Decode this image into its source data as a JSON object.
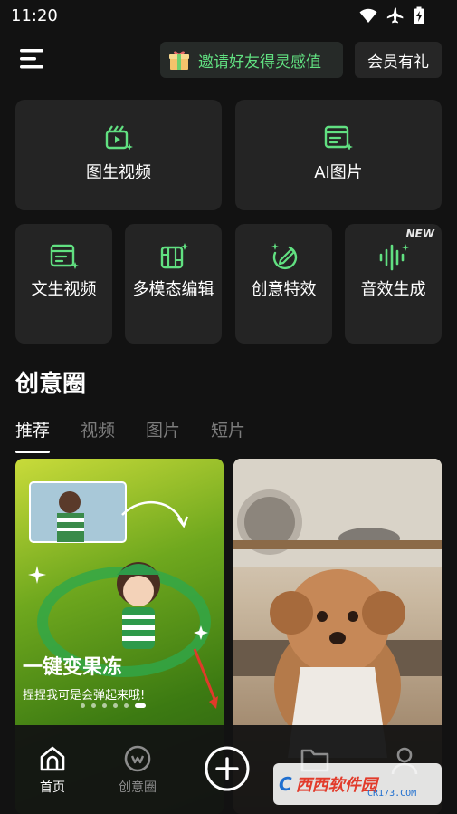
{
  "status_bar": {
    "time": "11:20",
    "icons": [
      "wifi-icon",
      "airplane-icon",
      "battery-charging-icon"
    ]
  },
  "header": {
    "invite_label": "邀请好友得灵感值",
    "vip_label": "会员有礼",
    "icons": [
      "menu-icon",
      "gift-icon"
    ]
  },
  "tools": {
    "large": [
      {
        "label": "图生视频",
        "icon": "image-to-video-icon"
      },
      {
        "label": "AI图片",
        "icon": "ai-image-icon"
      }
    ],
    "small": [
      {
        "label": "文生视频",
        "icon": "text-to-video-icon"
      },
      {
        "label": "多模态编辑",
        "icon": "multimodal-edit-icon"
      },
      {
        "label": "创意特效",
        "icon": "creative-effects-icon"
      },
      {
        "label": "音效生成",
        "icon": "sound-effect-icon",
        "badge": "NEW"
      }
    ]
  },
  "feed": {
    "section_title": "创意圈",
    "tabs": [
      "推荐",
      "视频",
      "图片",
      "短片"
    ],
    "active_tab": "推荐",
    "cards": [
      {
        "title": "一键变果冻",
        "subtitle": "捏捏我可是会弹起来哦!",
        "dots": 6,
        "active_dot": 5
      },
      {
        "title": "",
        "subtitle": ""
      }
    ]
  },
  "bottom_nav": {
    "items": [
      {
        "label": "首页",
        "icon": "home-icon",
        "active": true
      },
      {
        "label": "创意圈",
        "icon": "creative-circle-icon",
        "active": false
      },
      {
        "label": "",
        "icon": "add-icon"
      },
      {
        "label": "",
        "icon": "folder-icon"
      },
      {
        "label": "",
        "icon": "profile-icon"
      }
    ]
  },
  "watermark": {
    "logo": "C",
    "text": "西西软件园",
    "sub": "CR173.COM"
  },
  "colors": {
    "accent": "#61e081",
    "background": "#121212",
    "tile": "#242424"
  }
}
